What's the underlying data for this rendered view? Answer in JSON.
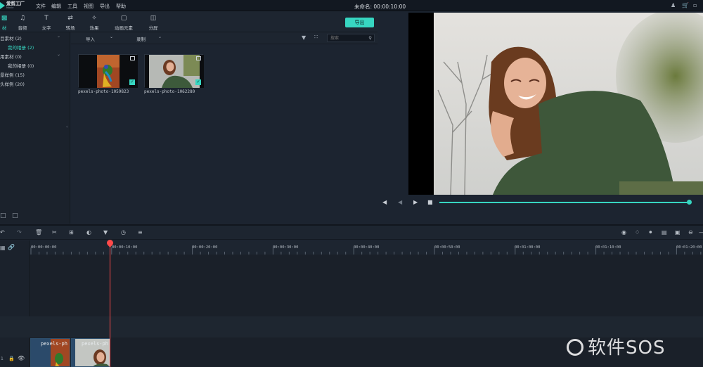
{
  "app": {
    "logo_text": "爱剪工厂",
    "logo_sub": "Movie",
    "doc_title": "未命名: 00:00:10:00"
  },
  "menu": [
    "文件",
    "编辑",
    "工具",
    "视图",
    "导出",
    "帮助"
  ],
  "tabs": [
    {
      "label": "材",
      "icon": "media-icon",
      "active": true
    },
    {
      "label": "音频",
      "icon": "music-note-icon"
    },
    {
      "label": "文字",
      "icon": "text-icon"
    },
    {
      "label": "转场",
      "icon": "transition-icon"
    },
    {
      "label": "效果",
      "icon": "effects-icon"
    },
    {
      "label": "动画元素",
      "icon": "image-icon"
    },
    {
      "label": "分屏",
      "icon": "split-screen-icon"
    }
  ],
  "export_label": "导出",
  "library": [
    {
      "label": "目素材 (2)",
      "caret": true
    },
    {
      "label": "我的相册 (2)",
      "selected": true,
      "indent": true
    },
    {
      "label": "用素材 (0)",
      "caret": true
    },
    {
      "label": "我的相册 (0)",
      "indent": true
    },
    {
      "label": "景样例 (15)"
    },
    {
      "label": "头样例 (20)"
    }
  ],
  "media_toolbar": {
    "import_label": "导入",
    "record_label": "录制",
    "search_placeholder": "搜索"
  },
  "media": [
    {
      "label": "pexels-photo-1059823"
    },
    {
      "label": "pexels-photo-1062280"
    }
  ],
  "ruler_labels": [
    "00:00:00:00",
    "00:00:10:00",
    "00:00:20:00",
    "00:00:30:00",
    "00:00:40:00",
    "00:00:50:00",
    "00:01:00:00",
    "00:01:10:00",
    "00:01:20:00"
  ],
  "clips": [
    {
      "label": "pexels-ph"
    },
    {
      "label": "pexels-ph"
    }
  ],
  "watermark": "软件SOS",
  "playback_progress": 1.0,
  "accent": "#37d6c1",
  "playhead_color": "#ff4a4a"
}
